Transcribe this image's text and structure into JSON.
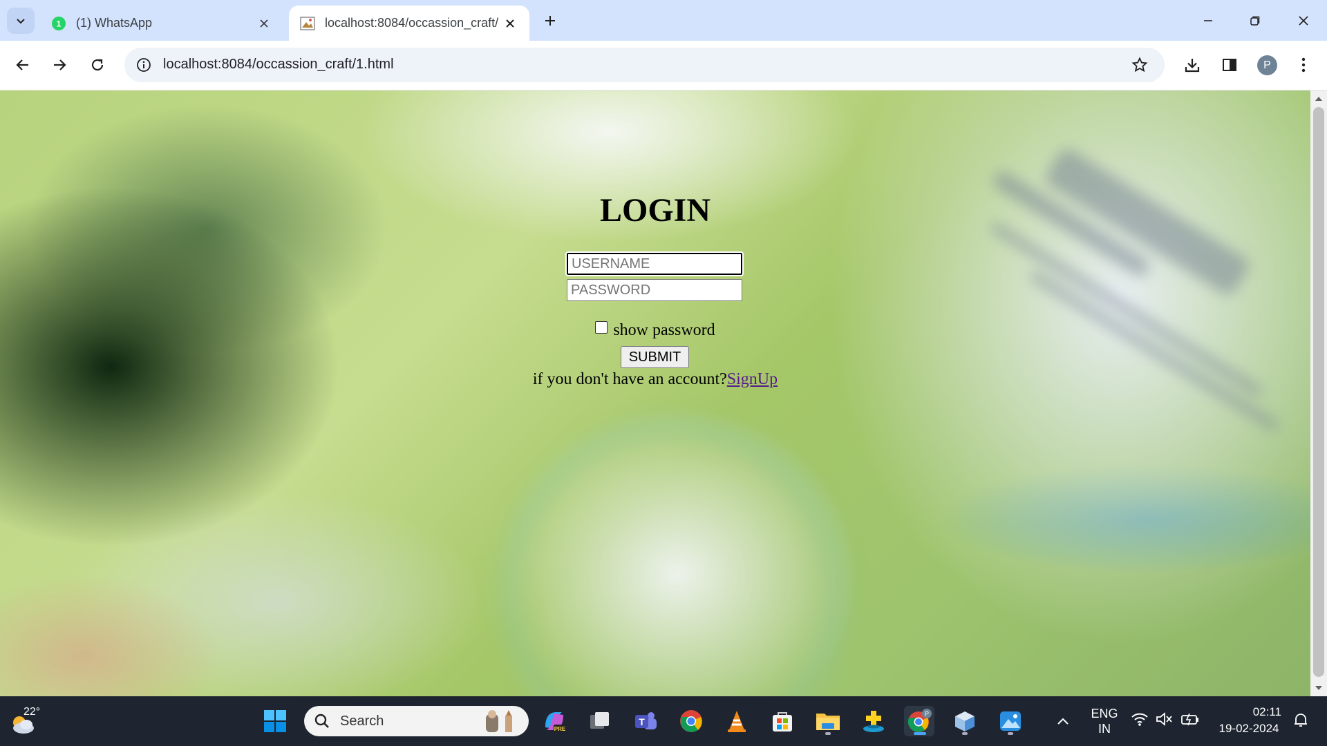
{
  "browser": {
    "tabs": [
      {
        "title": "(1) WhatsApp",
        "badge": "1",
        "active": false
      },
      {
        "title": "localhost:8084/occassion_craft/",
        "active": true
      }
    ],
    "url": "localhost:8084/occassion_craft/1.html",
    "profile_initial": "P"
  },
  "login": {
    "heading": "LOGIN",
    "username_placeholder": "USERNAME",
    "password_placeholder": "PASSWORD",
    "show_password_label": "show password",
    "show_password_checked": false,
    "submit_label": "SUBMIT",
    "signup_prompt": "if you don't have an account?",
    "signup_link": "SignUp"
  },
  "taskbar": {
    "weather_temp": "22°",
    "search_label": "Search",
    "lang_line1": "ENG",
    "lang_line2": "IN",
    "time": "02:11",
    "date": "19-02-2024",
    "pinned_apps": [
      "copilot-icon",
      "task-view-icon",
      "teams-icon",
      "chrome-icon",
      "vlc-icon",
      "store-icon",
      "file-explorer-icon",
      "health-app-icon",
      "chrome-profile-icon",
      "3d-box-icon",
      "photos-icon"
    ]
  },
  "colors": {
    "tabstrip_bg": "#d3e3fd",
    "taskbar_bg": "#1e2530",
    "link": "#551a8b"
  }
}
